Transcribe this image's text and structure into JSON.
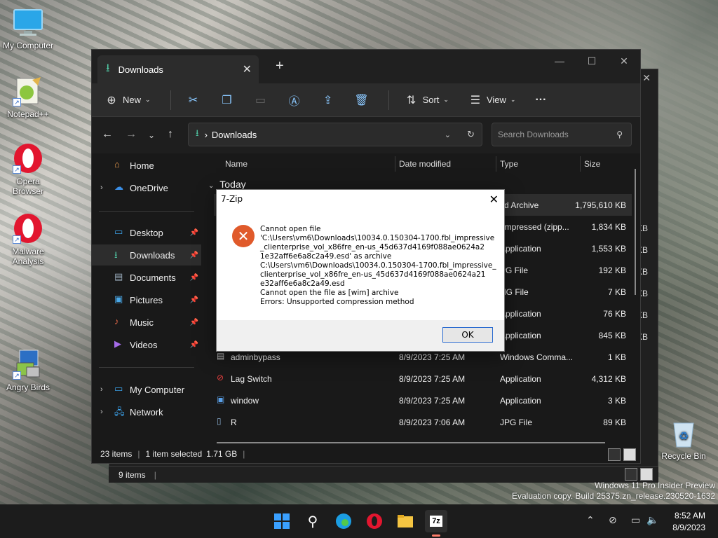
{
  "desktop": {
    "icons": [
      {
        "label": "My Computer"
      },
      {
        "label": "Notepad++"
      },
      {
        "label": "Opera Browser"
      },
      {
        "label": "Malware Analysis"
      },
      {
        "label": "Angry Birds"
      },
      {
        "label": "Recycle Bin"
      }
    ],
    "watermark_line1": "Windows 11 Pro Insider Preview",
    "watermark_line2": "Evaluation copy. Build 25375.zn_release.230520-1632"
  },
  "explorer": {
    "tab_title": "Downloads",
    "toolbar": {
      "new_label": "New",
      "sort_label": "Sort",
      "view_label": "View",
      "more_label": "···"
    },
    "address": {
      "path": "Downloads",
      "separator": "›"
    },
    "search": {
      "placeholder": "Search Downloads"
    },
    "sidebar": {
      "items": [
        {
          "label": "Home"
        },
        {
          "label": "OneDrive"
        },
        {
          "label": "Desktop"
        },
        {
          "label": "Downloads"
        },
        {
          "label": "Documents"
        },
        {
          "label": "Pictures"
        },
        {
          "label": "Music"
        },
        {
          "label": "Videos"
        },
        {
          "label": "My Computer"
        },
        {
          "label": "Network"
        }
      ]
    },
    "columns": {
      "name": "Name",
      "date": "Date modified",
      "type": "Type",
      "size": "Size"
    },
    "group": "Today",
    "rows": [
      {
        "name": "",
        "date": "",
        "type": "sd Archive",
        "size": "1,795,610 KB"
      },
      {
        "name": "",
        "date": "",
        "type": "ompressed (zipp...",
        "size": "1,834 KB"
      },
      {
        "name": "",
        "date": "",
        "type": "Application",
        "size": "1,553 KB"
      },
      {
        "name": "",
        "date": "",
        "type": "PG File",
        "size": "192 KB"
      },
      {
        "name": "",
        "date": "",
        "type": "NG File",
        "size": "7 KB"
      },
      {
        "name": "",
        "date": "",
        "type": "Application",
        "size": "76 KB"
      },
      {
        "name": "",
        "date": "",
        "type": "Application",
        "size": "845 KB"
      },
      {
        "name": "adminbypass",
        "date": "8/9/2023 7:25 AM",
        "type": "Windows Comma...",
        "size": "1 KB"
      },
      {
        "name": "Lag Switch",
        "date": "8/9/2023 7:25 AM",
        "type": "Application",
        "size": "4,312 KB"
      },
      {
        "name": "window",
        "date": "8/9/2023 7:25 AM",
        "type": "Application",
        "size": "3 KB"
      },
      {
        "name": "R",
        "date": "8/9/2023 7:06 AM",
        "type": "JPG File",
        "size": "89 KB"
      }
    ],
    "status": {
      "count": "23 items",
      "selected": "1 item selected",
      "size": "1.71 GB"
    },
    "ghost_status": "9 items",
    "ghost_sizes": [
      "KB",
      "KB",
      "KB",
      "KB",
      "KB",
      "KB"
    ]
  },
  "dialog": {
    "title": "7-Zip",
    "lines": [
      "Cannot open file",
      "'C:\\Users\\vm6\\Downloads\\10034.0.150304-1700.fbl_impressive",
      "_clienterprise_vol_x86fre_en-us_45d637d4169f088ae0624a2",
      "1e32aff6e6a8c2a49.esd' as archive",
      "C:\\Users\\vm6\\Downloads\\10034.0.150304-1700.fbl_impressive_",
      "clienterprise_vol_x86fre_en-us_45d637d4169f088ae0624a21",
      "e32aff6e6a8c2a49.esd",
      "Cannot open the file as [wim] archive",
      "Errors: Unsupported compression method"
    ],
    "ok_label": "OK"
  },
  "taskbar": {
    "time": "8:52 AM",
    "date": "8/9/2023"
  }
}
